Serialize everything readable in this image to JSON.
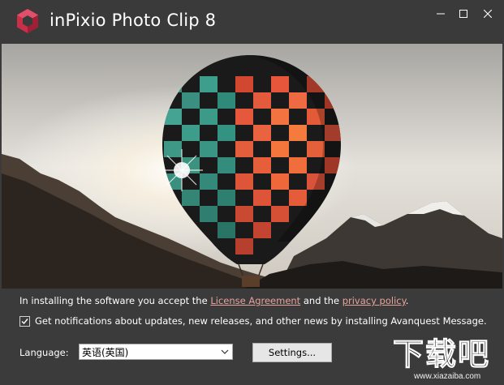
{
  "window": {
    "title": "inPixio Photo Clip 8",
    "controls": {
      "minimize": "minimize-icon",
      "maximize": "maximize-icon",
      "close": "close-icon"
    }
  },
  "hero": {
    "image": "hot-air-balloon-over-mountains"
  },
  "consent": {
    "prefix": "In installing the software you accept the ",
    "license_link": "License Agreement",
    "middle": " and the ",
    "privacy_link": "privacy policy",
    "suffix": "."
  },
  "notifications": {
    "checked": true,
    "label": "Get notifications about updates, new releases, and other news by installing Avanquest Message."
  },
  "language": {
    "label": "Language:",
    "selected": "英语(英国)"
  },
  "settings_button": "Settings...",
  "watermark": {
    "main": "下载吧",
    "url": "www.xiazaiba.com"
  },
  "colors": {
    "background": "#3b3b3b",
    "link": "#e8a29c",
    "brand": "#c8304a"
  }
}
